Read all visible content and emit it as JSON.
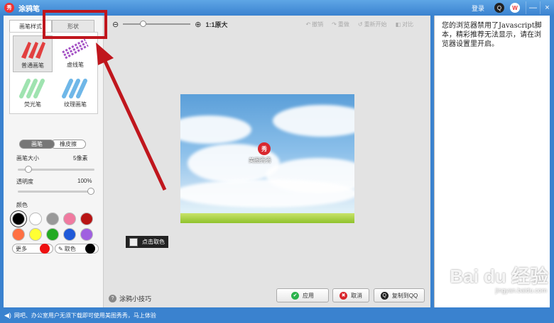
{
  "window": {
    "title": "涂鸦笔",
    "logo_text": "秀",
    "login": "登录",
    "qq_icon_glyph": "Q",
    "weibo_icon_glyph": "W",
    "minimize": "—",
    "close": "×"
  },
  "left": {
    "tabs": [
      "画笔样式",
      "形状"
    ],
    "brushes": [
      {
        "label": "普通画笔",
        "color": "#e23f3f"
      },
      {
        "label": "虚线笔",
        "color": "#a34fc4"
      },
      {
        "label": "荧光笔",
        "color": "#9fe3b0"
      },
      {
        "label": "纹理画笔",
        "color": "#6fb7e8"
      }
    ],
    "modes": [
      "画笔",
      "橡皮擦"
    ],
    "size_label": "画笔大小",
    "size_value": "5像素",
    "size_level": 0.1,
    "opacity_label": "透明度",
    "opacity_value": "100%",
    "opacity_level": 1.0,
    "color_label": "颜色",
    "colors": [
      "#000000",
      "#ffffff",
      "#999999",
      "#f07aa0",
      "#b81414",
      "#ff7043",
      "#ffff33",
      "#22aa22",
      "#1f59d8",
      "#a060e0"
    ],
    "more_label": "更多",
    "more_color": "#ee1111",
    "pick_label": "取色",
    "pick_color": "#000000"
  },
  "toolbar": {
    "zoom_out_icon": "⊖",
    "zoom_in_icon": "⊕",
    "original": "1:1原大",
    "undo": "撤销",
    "redo": "重做",
    "restart": "重新开始",
    "compare": "对比"
  },
  "photo": {
    "icon_text": "秀",
    "label": "美图秀秀"
  },
  "tooltip": "点击取色",
  "tips": {
    "icon": "?",
    "text": "涂鸦小技巧"
  },
  "actions": {
    "apply": {
      "label": "应用",
      "icon": "✔",
      "color": "#2bb24c"
    },
    "cancel": {
      "label": "取消",
      "icon": "✖",
      "color": "#d9262c"
    },
    "copy": {
      "label": "复制到QQ",
      "icon": "Q",
      "color": "#222222"
    }
  },
  "right": {
    "message": "您的浏览器禁用了Javascript脚本，精彩推荐无法显示，请在浏览器设置里开启。"
  },
  "status": {
    "icon": "◀)",
    "text": "网吧、办公室用户无须下载即可使用美图秀秀，马上体验"
  },
  "watermark": {
    "main": "Bai du 经验",
    "sub": "jingyan.baidu.com"
  }
}
